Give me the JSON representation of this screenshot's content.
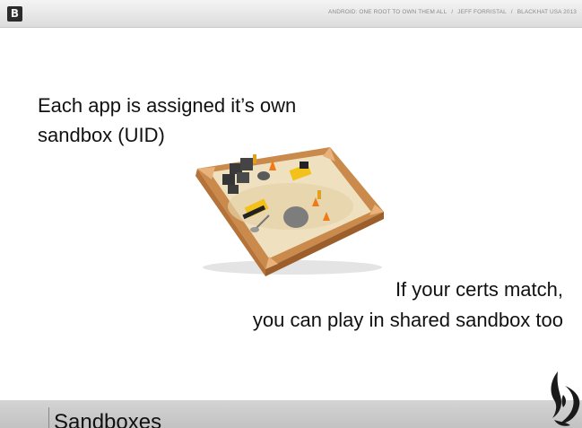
{
  "header": {
    "logo_letter": "B",
    "talk_title": "ANDROID: ONE ROOT TO OWN THEM ALL",
    "separator": "/",
    "author": "JEFF FORRISTAL",
    "event": "BLACKHAT USA 2013"
  },
  "slide": {
    "text_line1": "Each app is assigned it’s own",
    "text_line2": "sandbox (UID)",
    "text_right_line1": "If your certs match,",
    "text_right_line2": "you can play in shared sandbox too"
  },
  "footer": {
    "title": "Sandboxes"
  },
  "colors": {
    "header_bg": "#e6e6e6",
    "footer_bg": "#c8c8c8",
    "wood": "#c8864a",
    "sand": "#efe0c0",
    "toy_yellow": "#f2c21b"
  },
  "icons": {
    "logo": "blackhat-logo",
    "image": "sandbox-toy-image",
    "footer_logo": "tribal-logo"
  }
}
